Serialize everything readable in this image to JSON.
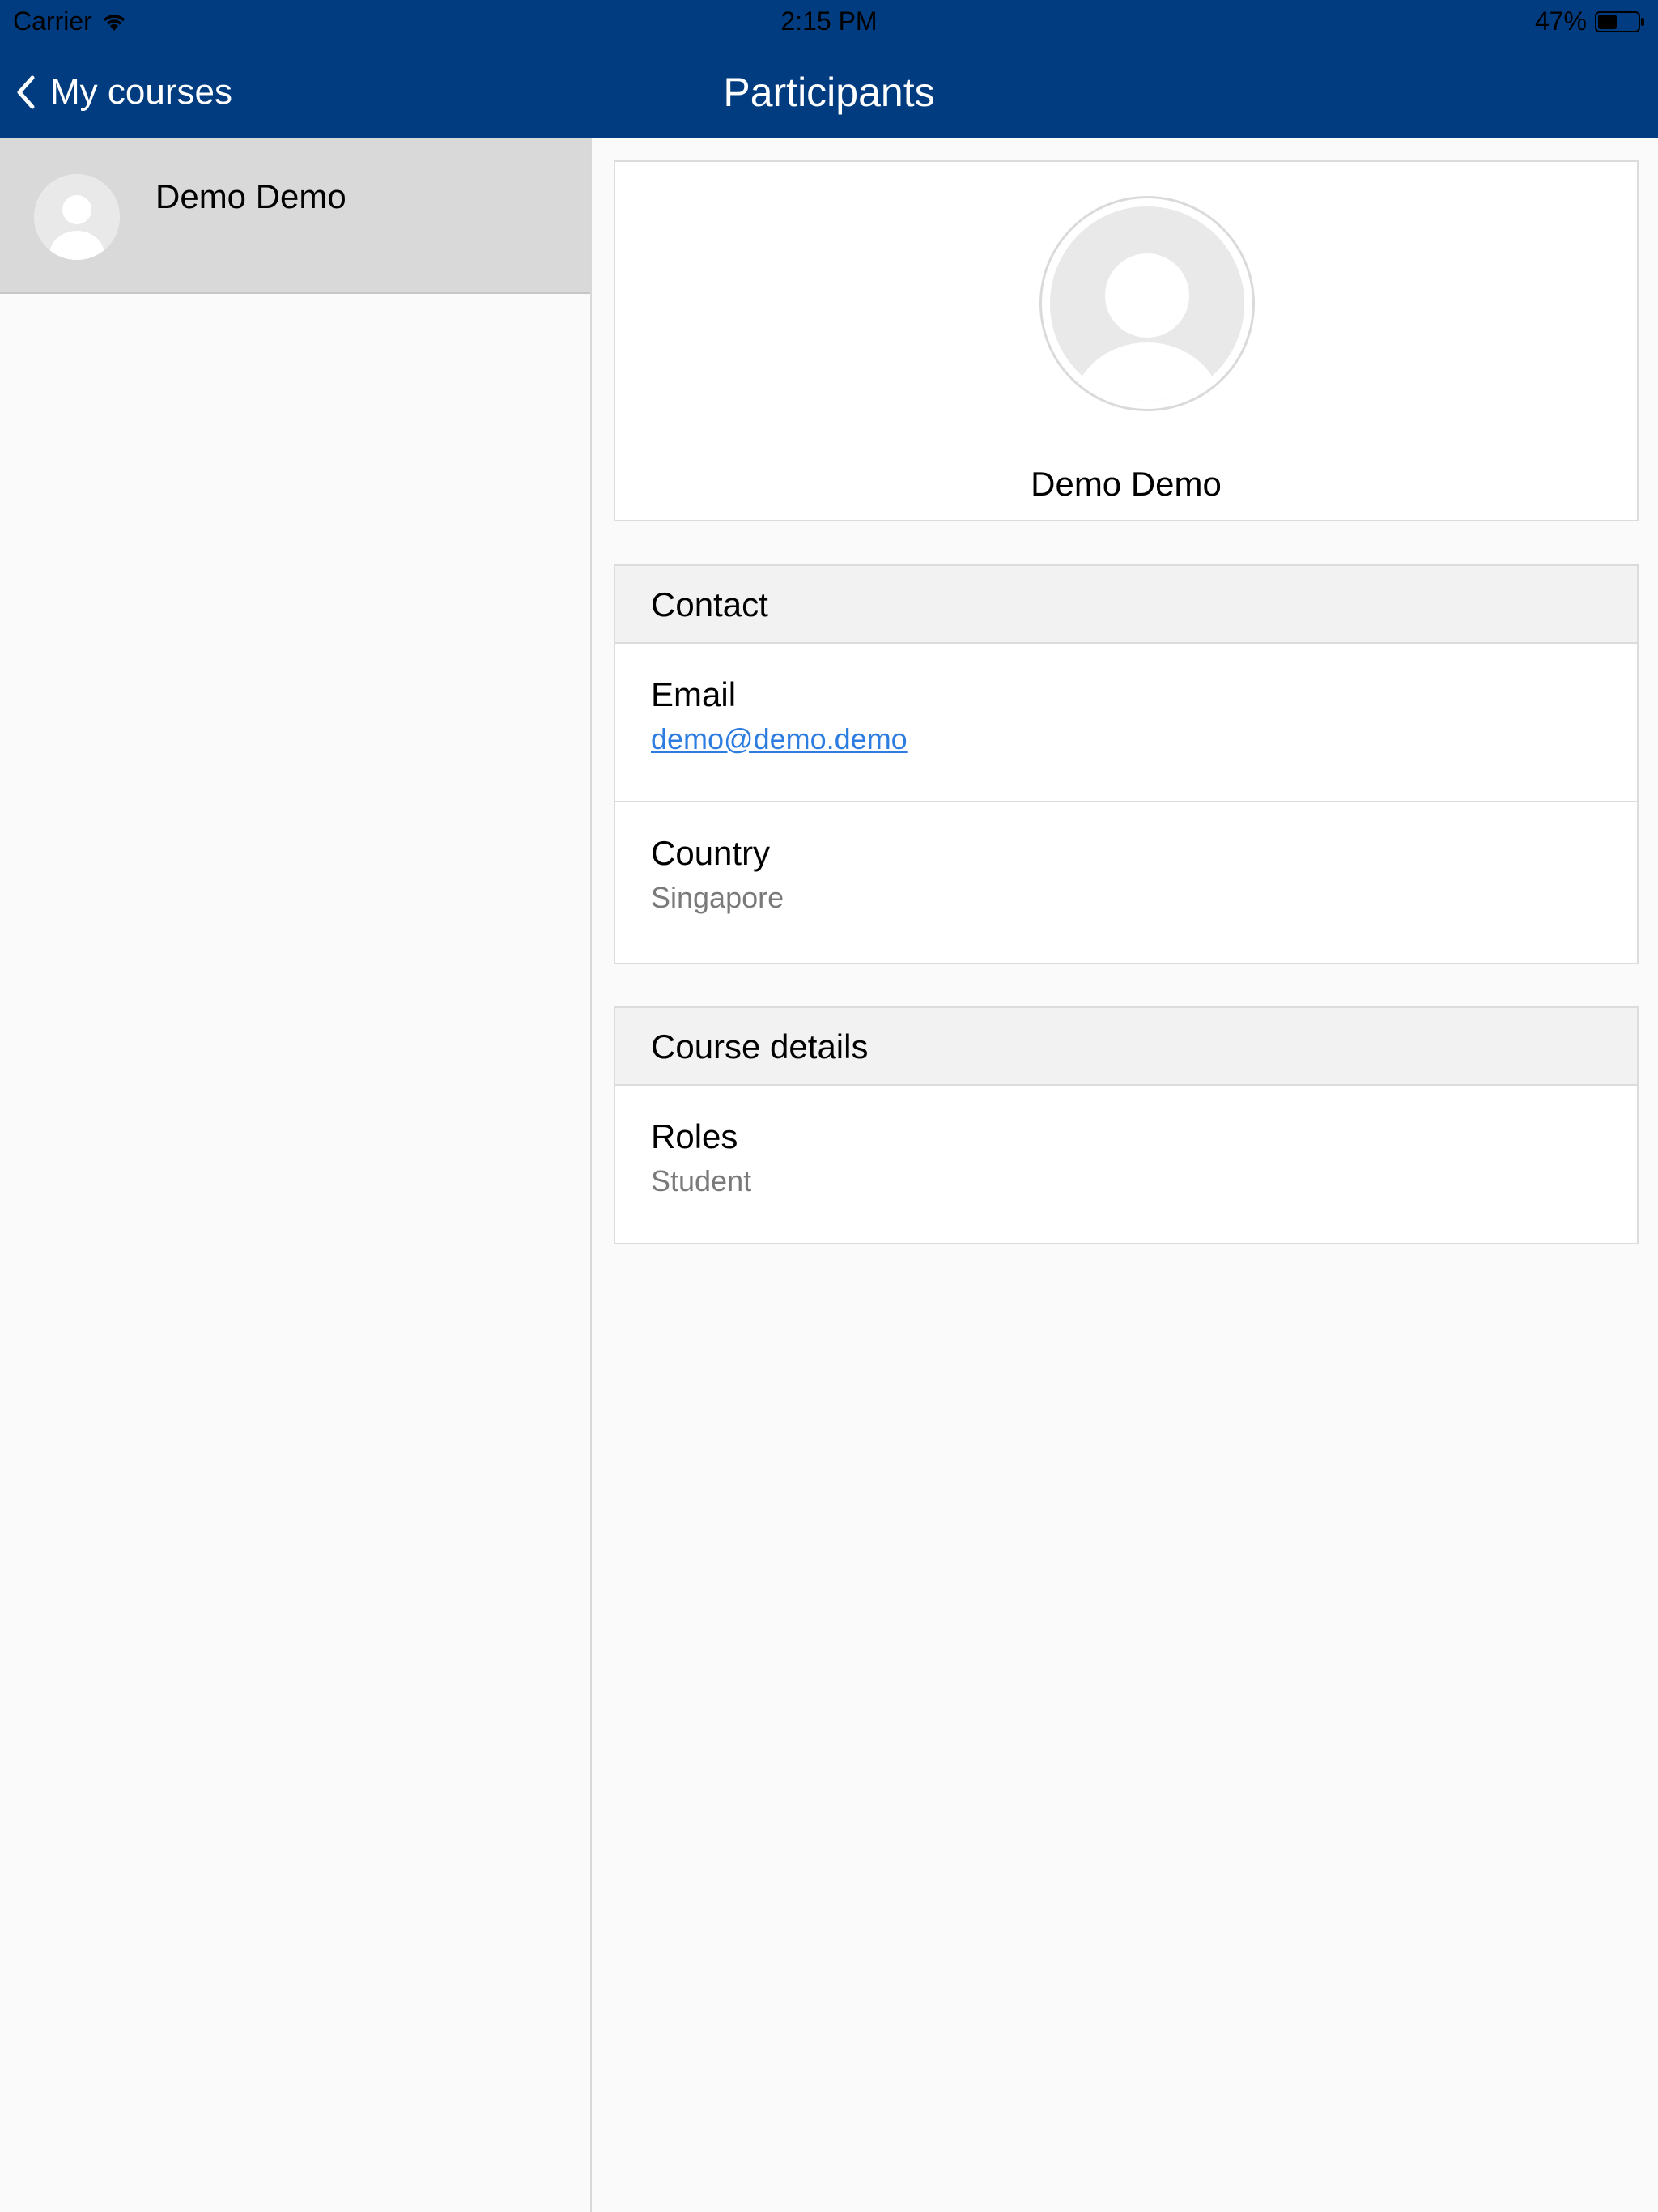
{
  "status": {
    "carrier": "Carrier",
    "time": "2:15 PM",
    "battery": "47%",
    "battery_level": 0.47
  },
  "nav": {
    "back_label": "My courses",
    "title": "Participants"
  },
  "participants": [
    {
      "name": "Demo Demo",
      "selected": true
    }
  ],
  "profile": {
    "name": "Demo Demo"
  },
  "contact": {
    "header": "Contact",
    "email_label": "Email",
    "email_value": "demo@demo.demo",
    "country_label": "Country",
    "country_value": "Singapore"
  },
  "course_details": {
    "header": "Course details",
    "roles_label": "Roles",
    "roles_value": "Student"
  },
  "colors": {
    "nav_bg": "#003c7f",
    "link": "#2d7de0"
  }
}
